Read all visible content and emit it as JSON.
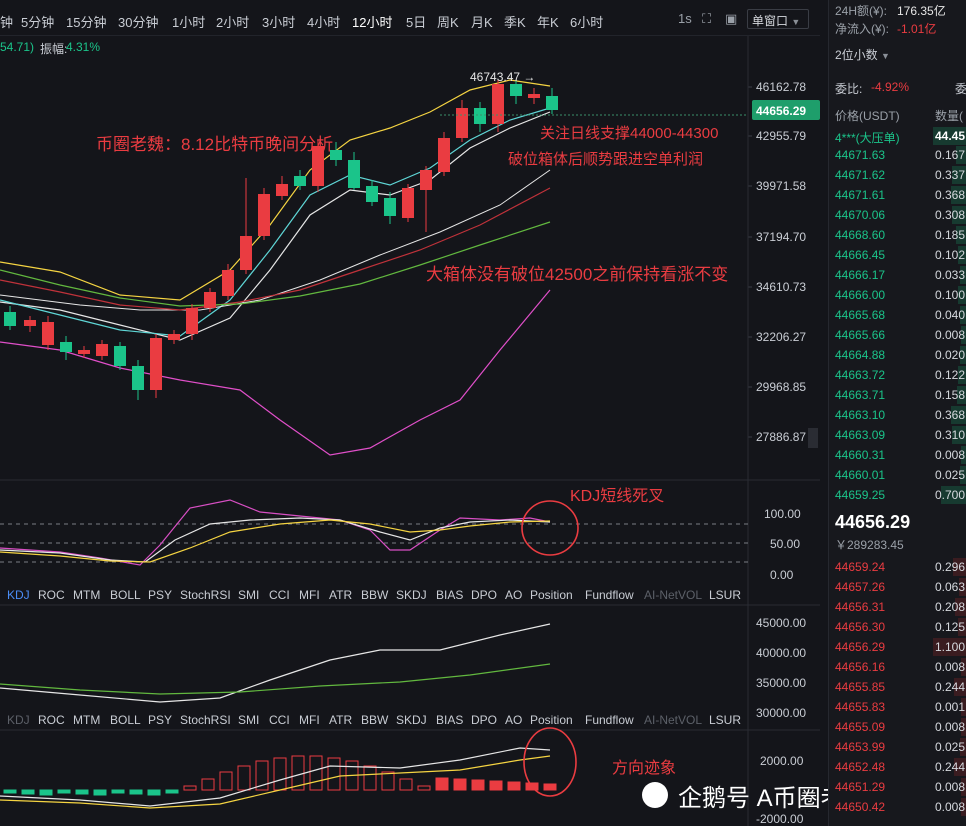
{
  "toolbar": {
    "timeframes": [
      "钟",
      "5分钟",
      "15分钟",
      "30分钟",
      "1小时",
      "2小时",
      "3小时",
      "4小时",
      "12小时",
      "5日",
      "周K",
      "月K",
      "季K",
      "年K",
      "6小时"
    ],
    "active_timeframe": "12小时",
    "interval_label": "1s",
    "window_mode": "单窗口"
  },
  "main_chart": {
    "info_prefix": "54.71)",
    "amplitude_label": "振幅:",
    "amplitude_value": "4.31%",
    "price_axis": [
      "46162.78",
      "42955.79",
      "39971.58",
      "37194.70",
      "34610.73",
      "32206.27",
      "29968.85",
      "27886.87"
    ],
    "current_price": "44656.29",
    "peak_label": "46743.47 →"
  },
  "annotations": {
    "title": "币圈老魏：8.12比特币晚间分析",
    "support": "关注日线支撑44000-44300",
    "breakout": "破位箱体后顺势跟进空单利润",
    "outlook": "大箱体没有破位42500之前保持看涨不变",
    "kdj": "KDJ短线死叉",
    "direction": "方向迹象"
  },
  "indicator_tabs": [
    "KDJ",
    "ROC",
    "MTM",
    "BOLL",
    "PSY",
    "StochRSI",
    "SMI",
    "CCI",
    "MFI",
    "ATR",
    "BBW",
    "SKDJ",
    "BIAS",
    "DPO",
    "AO",
    "Position",
    "Fundflow",
    "AI-NetVOL",
    "LSUR"
  ],
  "kdj_axis": [
    "100.00",
    "50.00",
    "0.00"
  ],
  "position_axis": [
    "45000.00",
    "40000.00",
    "35000.00",
    "30000.00"
  ],
  "macd_axis": [
    "2000.00",
    "-2000.00"
  ],
  "right_panel": {
    "volume_24h_label": "24H额(¥):",
    "volume_24h_value": "176.35亿",
    "net_inflow_label": "净流入(¥):",
    "net_inflow_value": "-1.01亿",
    "decimal_label": "2位小数",
    "ratio_label": "委比:",
    "ratio_value": "-4.92%",
    "ratio_extra": "委",
    "price_header": "价格(USDT)",
    "qty_header": "数量(",
    "big_order_price": "4***(大压单)",
    "big_order_qty": "44.45",
    "bids": [
      {
        "price": "44671.63",
        "qty": "0.167"
      },
      {
        "price": "44671.62",
        "qty": "0.337"
      },
      {
        "price": "44671.61",
        "qty": "0.368"
      },
      {
        "price": "44670.06",
        "qty": "0.308"
      },
      {
        "price": "44668.60",
        "qty": "0.185"
      },
      {
        "price": "44666.45",
        "qty": "0.102"
      },
      {
        "price": "44666.17",
        "qty": "0.033"
      },
      {
        "price": "44666.00",
        "qty": "0.100"
      },
      {
        "price": "44665.68",
        "qty": "0.040"
      },
      {
        "price": "44665.66",
        "qty": "0.008"
      },
      {
        "price": "44664.88",
        "qty": "0.020"
      },
      {
        "price": "44663.72",
        "qty": "0.122"
      },
      {
        "price": "44663.71",
        "qty": "0.158"
      },
      {
        "price": "44663.10",
        "qty": "0.368"
      },
      {
        "price": "44663.09",
        "qty": "0.310"
      },
      {
        "price": "44660.31",
        "qty": "0.008"
      },
      {
        "price": "44660.01",
        "qty": "0.025"
      },
      {
        "price": "44659.25",
        "qty": "0.700"
      }
    ],
    "last_price": "44656.29",
    "last_price_cny": "￥289283.45",
    "asks": [
      {
        "price": "44659.24",
        "qty": "0.296"
      },
      {
        "price": "44657.26",
        "qty": "0.063"
      },
      {
        "price": "44656.31",
        "qty": "0.208"
      },
      {
        "price": "44656.30",
        "qty": "0.125"
      },
      {
        "price": "44656.29",
        "qty": "1.100"
      },
      {
        "price": "44656.16",
        "qty": "0.008"
      },
      {
        "price": "44655.85",
        "qty": "0.244"
      },
      {
        "price": "44655.83",
        "qty": "0.001"
      },
      {
        "price": "44655.09",
        "qty": "0.008"
      },
      {
        "price": "44653.99",
        "qty": "0.025"
      },
      {
        "price": "44652.48",
        "qty": "0.244"
      },
      {
        "price": "44651.29",
        "qty": "0.008"
      },
      {
        "price": "44650.42",
        "qty": "0.008"
      }
    ]
  },
  "watermark": "企鹅号 A币圈老魏"
}
